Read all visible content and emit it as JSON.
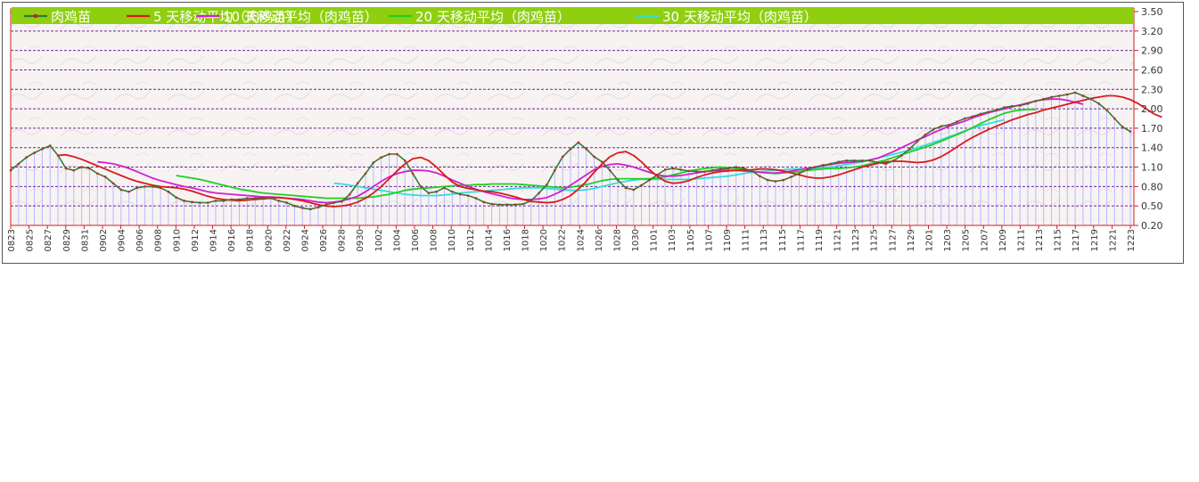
{
  "chart_data": {
    "type": "line",
    "colors": {
      "price": "#2e7d32",
      "price_marker": "#c62828",
      "ma5": "#d81b1b",
      "ma10": "#d21fd2",
      "ma20": "#1fd01f",
      "ma30": "#33dddd",
      "bars": "#b9b9ff",
      "legend_bg": "#8fcf0f",
      "plot_bg": "#f7f3f3",
      "grid": "#6b2a9a",
      "axis": "#cc2222"
    },
    "legend": {
      "placement": "top",
      "items": [
        {
          "key": "price",
          "label": "肉鸡苗"
        },
        {
          "key": "ma5",
          "label": "5 天移动平均（肉鸡苗）"
        },
        {
          "key": "ma10",
          "label": "10 天移动平均（肉鸡苗）"
        },
        {
          "key": "ma20",
          "label": "20 天移动平均（肉鸡苗）"
        },
        {
          "key": "ma30",
          "label": "30 天移动平均（肉鸡苗）"
        }
      ]
    },
    "y_axis": {
      "position": "right",
      "ticks": [
        "0.20",
        "0.50",
        "0.80",
        "1.10",
        "1.40",
        "1.70",
        "2.00",
        "2.30",
        "2.60",
        "2.90",
        "3.20",
        "3.50"
      ],
      "ylim": [
        0.2,
        3.5
      ],
      "grid": true
    },
    "x_axis": {
      "ticks": [
        "0823",
        "0825",
        "0827",
        "0829",
        "0831",
        "0902",
        "0904",
        "0906",
        "0908",
        "0910",
        "0912",
        "0914",
        "0916",
        "0918",
        "0920",
        "0922",
        "0924",
        "0926",
        "0928",
        "0930",
        "1002",
        "1004",
        "1006",
        "1008",
        "1010",
        "1012",
        "1014",
        "1016",
        "1018",
        "1020",
        "1022",
        "1024",
        "1026",
        "1028",
        "1030",
        "1101",
        "1103",
        "1105",
        "1107",
        "1109",
        "1111",
        "1113",
        "1115",
        "1117",
        "1119",
        "1121",
        "1123",
        "1125",
        "1127",
        "1129",
        "1201",
        "1203",
        "1205",
        "1207",
        "1209",
        "1211",
        "1213",
        "1215",
        "1217",
        "1219",
        "1221",
        "1223"
      ]
    },
    "series": [
      {
        "key": "price",
        "values": [
          1.05,
          1.15,
          1.25,
          1.32,
          1.38,
          1.43,
          1.28,
          1.08,
          1.05,
          1.1,
          1.08,
          1.0,
          0.95,
          0.85,
          0.75,
          0.72,
          0.78,
          0.8,
          0.8,
          0.78,
          0.72,
          0.63,
          0.58,
          0.56,
          0.55,
          0.55,
          0.58,
          0.58,
          0.6,
          0.6,
          0.62,
          0.62,
          0.63,
          0.62,
          0.58,
          0.55,
          0.5,
          0.47,
          0.45,
          0.48,
          0.52,
          0.55,
          0.57,
          0.68,
          0.85,
          1.0,
          1.17,
          1.25,
          1.3,
          1.3,
          1.2,
          1.0,
          0.8,
          0.7,
          0.72,
          0.78,
          0.72,
          0.68,
          0.66,
          0.62,
          0.56,
          0.53,
          0.52,
          0.52,
          0.52,
          0.53,
          0.58,
          0.7,
          0.83,
          1.05,
          1.26,
          1.38,
          1.48,
          1.38,
          1.26,
          1.18,
          1.05,
          0.9,
          0.78,
          0.75,
          0.82,
          0.9,
          0.98,
          1.06,
          1.08,
          1.06,
          1.04,
          1.03,
          1.03,
          1.05,
          1.07,
          1.08,
          1.1,
          1.08,
          1.04,
          0.96,
          0.9,
          0.88,
          0.9,
          0.95,
          1.0,
          1.06,
          1.1,
          1.13,
          1.15,
          1.18,
          1.2,
          1.2,
          1.2,
          1.2,
          1.17,
          1.15,
          1.2,
          1.28,
          1.38,
          1.5,
          1.6,
          1.68,
          1.73,
          1.75,
          1.8,
          1.85,
          1.88,
          1.92,
          1.95,
          1.98,
          2.02,
          2.04,
          2.05,
          2.08,
          2.12,
          2.15,
          2.18,
          2.2,
          2.22,
          2.25,
          2.2,
          2.15,
          2.08,
          1.98,
          1.85,
          1.72,
          1.65
        ]
      },
      {
        "key": "ma5",
        "start": 6,
        "values": [
          1.28,
          1.29,
          1.26,
          1.22,
          1.17,
          1.12,
          1.07,
          1.02,
          0.97,
          0.92,
          0.88,
          0.85,
          0.82,
          0.8,
          0.79,
          0.78,
          0.76,
          0.73,
          0.69,
          0.65,
          0.62,
          0.6,
          0.59,
          0.58,
          0.59,
          0.6,
          0.61,
          0.62,
          0.63,
          0.62,
          0.6,
          0.58,
          0.55,
          0.52,
          0.5,
          0.49,
          0.5,
          0.52,
          0.56,
          0.62,
          0.7,
          0.8,
          0.92,
          1.04,
          1.15,
          1.23,
          1.25,
          1.2,
          1.1,
          0.98,
          0.87,
          0.8,
          0.77,
          0.75,
          0.73,
          0.72,
          0.7,
          0.67,
          0.64,
          0.6,
          0.57,
          0.56,
          0.55,
          0.56,
          0.6,
          0.66,
          0.76,
          0.88,
          1.02,
          1.15,
          1.26,
          1.32,
          1.34,
          1.28,
          1.18,
          1.06,
          0.96,
          0.88,
          0.85,
          0.86,
          0.89,
          0.94,
          0.98,
          1.01,
          1.03,
          1.04,
          1.05,
          1.05,
          1.06,
          1.07,
          1.07,
          1.06,
          1.04,
          1.01,
          0.98,
          0.95,
          0.93,
          0.93,
          0.95,
          0.98,
          1.02,
          1.06,
          1.1,
          1.13,
          1.16,
          1.18,
          1.19,
          1.19,
          1.18,
          1.17,
          1.18,
          1.21,
          1.26,
          1.33,
          1.41,
          1.49,
          1.56,
          1.62,
          1.68,
          1.73,
          1.78,
          1.83,
          1.87,
          1.91,
          1.94,
          1.98,
          2.01,
          2.04,
          2.07,
          2.1,
          2.13,
          2.16,
          2.18,
          2.2,
          2.2,
          2.18,
          2.14,
          2.08,
          2.0,
          1.92,
          1.87
        ]
      },
      {
        "key": "ma10",
        "start": 11,
        "values": [
          1.18,
          1.17,
          1.15,
          1.12,
          1.08,
          1.03,
          0.98,
          0.93,
          0.89,
          0.86,
          0.83,
          0.8,
          0.78,
          0.75,
          0.72,
          0.7,
          0.69,
          0.68,
          0.67,
          0.66,
          0.65,
          0.64,
          0.64,
          0.63,
          0.62,
          0.61,
          0.6,
          0.58,
          0.56,
          0.55,
          0.56,
          0.58,
          0.61,
          0.65,
          0.72,
          0.8,
          0.88,
          0.95,
          1.0,
          1.03,
          1.05,
          1.05,
          1.04,
          1.01,
          0.96,
          0.9,
          0.85,
          0.8,
          0.76,
          0.72,
          0.69,
          0.66,
          0.63,
          0.61,
          0.6,
          0.6,
          0.61,
          0.63,
          0.68,
          0.74,
          0.82,
          0.9,
          0.98,
          1.06,
          1.11,
          1.14,
          1.15,
          1.13,
          1.1,
          1.06,
          1.02,
          0.98,
          0.96,
          0.96,
          0.97,
          0.99,
          1.01,
          1.03,
          1.04,
          1.05,
          1.05,
          1.05,
          1.04,
          1.03,
          1.02,
          1.01,
          1.01,
          1.02,
          1.04,
          1.06,
          1.08,
          1.1,
          1.12,
          1.14,
          1.16,
          1.17,
          1.18,
          1.19,
          1.21,
          1.24,
          1.29,
          1.34,
          1.4,
          1.46,
          1.52,
          1.57,
          1.63,
          1.68,
          1.73,
          1.77,
          1.81,
          1.86,
          1.9,
          1.94,
          1.97,
          2.0,
          2.03,
          2.06,
          2.09,
          2.12,
          2.14,
          2.15,
          2.15,
          2.13,
          2.1,
          2.07
        ]
      },
      {
        "key": "ma20",
        "start": 21,
        "values": [
          0.97,
          0.95,
          0.93,
          0.91,
          0.88,
          0.85,
          0.82,
          0.79,
          0.76,
          0.74,
          0.72,
          0.7,
          0.69,
          0.68,
          0.67,
          0.66,
          0.65,
          0.64,
          0.63,
          0.62,
          0.62,
          0.62,
          0.62,
          0.62,
          0.63,
          0.64,
          0.66,
          0.68,
          0.71,
          0.74,
          0.76,
          0.77,
          0.78,
          0.79,
          0.8,
          0.81,
          0.82,
          0.82,
          0.83,
          0.83,
          0.84,
          0.84,
          0.84,
          0.84,
          0.83,
          0.82,
          0.81,
          0.8,
          0.79,
          0.78,
          0.79,
          0.81,
          0.83,
          0.86,
          0.89,
          0.91,
          0.92,
          0.92,
          0.92,
          0.92,
          0.92,
          0.93,
          0.95,
          0.98,
          1.01,
          1.04,
          1.06,
          1.08,
          1.09,
          1.1,
          1.09,
          1.08,
          1.06,
          1.04,
          1.02,
          1.01,
          1.0,
          1.01,
          1.02,
          1.03,
          1.05,
          1.06,
          1.07,
          1.08,
          1.08,
          1.09,
          1.1,
          1.12,
          1.15,
          1.18,
          1.21,
          1.25,
          1.29,
          1.33,
          1.37,
          1.41,
          1.45,
          1.5,
          1.55,
          1.6,
          1.65,
          1.71,
          1.77,
          1.83,
          1.88,
          1.93,
          1.96,
          1.98,
          1.99,
          1.99
        ]
      },
      {
        "key": "ma30",
        "start": 41,
        "values": [
          0.85,
          0.84,
          0.82,
          0.8,
          0.78,
          0.76,
          0.74,
          0.72,
          0.7,
          0.68,
          0.67,
          0.66,
          0.66,
          0.66,
          0.67,
          0.68,
          0.7,
          0.71,
          0.72,
          0.73,
          0.74,
          0.75,
          0.76,
          0.77,
          0.78,
          0.78,
          0.78,
          0.77,
          0.76,
          0.75,
          0.74,
          0.74,
          0.75,
          0.77,
          0.8,
          0.83,
          0.86,
          0.88,
          0.9,
          0.91,
          0.91,
          0.91,
          0.91,
          0.91,
          0.91,
          0.91,
          0.92,
          0.93,
          0.94,
          0.95,
          0.96,
          0.98,
          1.0,
          1.02,
          1.03,
          1.04,
          1.05,
          1.06,
          1.07,
          1.07,
          1.08,
          1.08,
          1.09,
          1.1,
          1.12,
          1.14,
          1.16,
          1.18,
          1.21,
          1.24,
          1.27,
          1.3,
          1.33,
          1.36,
          1.4,
          1.44,
          1.48,
          1.52,
          1.57,
          1.61,
          1.66,
          1.7,
          1.74,
          1.77,
          1.8,
          1.83
        ]
      }
    ]
  }
}
